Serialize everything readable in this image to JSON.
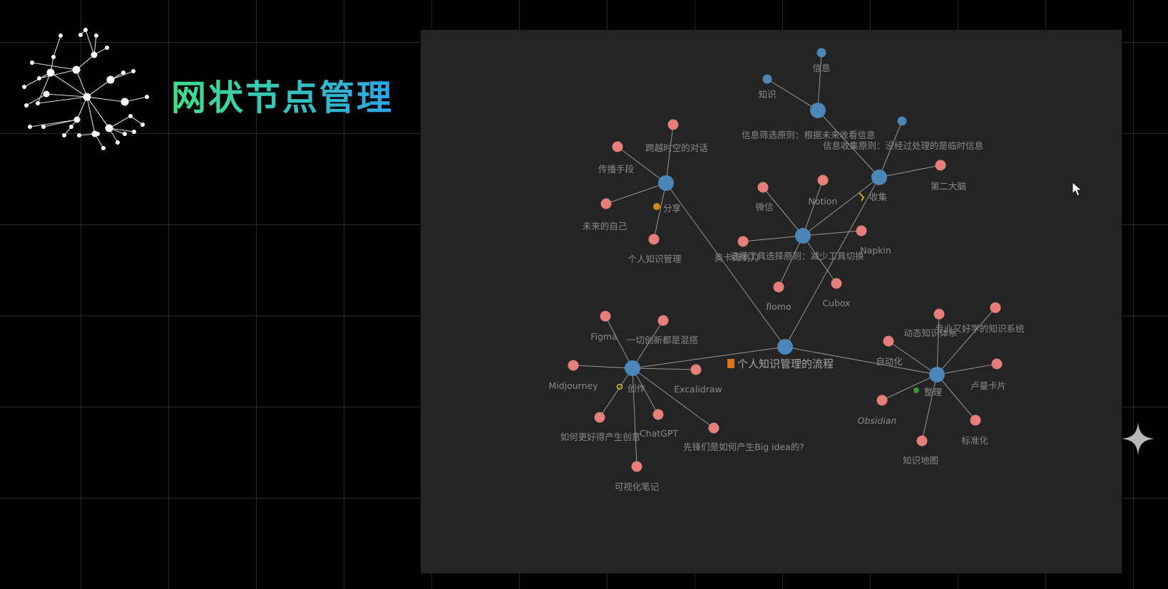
{
  "title": "网状节点管理",
  "icons": {
    "logo": "network-graph-icon",
    "cursor": "mouse-cursor-icon",
    "sparkle": "sparkle-icon"
  },
  "colors": {
    "title_gradient_start": "#3fe08a",
    "title_gradient_end": "#2ba4e8",
    "panel_bg": "#242424",
    "hub_node": "#4b86b8",
    "leaf_node": "#e57f7a",
    "edge": "#bdbdbd",
    "label": "#8a8a8a"
  },
  "graph": {
    "nodes": [
      {
        "id": "root",
        "label": "个人知识管理的流程",
        "kind": "hub",
        "main": true,
        "marker": "note-icon"
      },
      {
        "id": "collect",
        "label": "收集",
        "kind": "hub",
        "marker": "tag-icon"
      },
      {
        "id": "tools",
        "label": "选择工具选择原则：减少工具切换",
        "kind": "hub"
      },
      {
        "id": "share",
        "label": "分享",
        "kind": "hub",
        "marker": "dot-icon"
      },
      {
        "id": "create",
        "label": "创作",
        "kind": "hub",
        "marker": "bulb-icon"
      },
      {
        "id": "organize",
        "label": "整理",
        "kind": "hub",
        "marker": "leaf-icon"
      },
      {
        "id": "filter",
        "label": "信息筛选原则：根据未来收看信息",
        "kind": "hub"
      },
      {
        "id": "info",
        "label": "信息",
        "kind": "hub-small"
      },
      {
        "id": "knowledge",
        "label": "知识",
        "kind": "hub-small"
      },
      {
        "id": "collect-rule",
        "label": "信息收集原则：没经过处理的是临时信息",
        "kind": "hub-small"
      },
      {
        "id": "second-brain",
        "label": "第二大脑",
        "kind": "leaf"
      },
      {
        "id": "wechat",
        "label": "微信",
        "kind": "leaf"
      },
      {
        "id": "notion",
        "label": "Notion",
        "kind": "leaf"
      },
      {
        "id": "napkin",
        "label": "Napkin",
        "kind": "leaf"
      },
      {
        "id": "thoughts",
        "label": "奥卡姆剃刀",
        "kind": "leaf"
      },
      {
        "id": "flomo",
        "label": "flomo",
        "kind": "leaf"
      },
      {
        "id": "cubox",
        "label": "Cubox",
        "kind": "leaf"
      },
      {
        "id": "dialog",
        "label": "跨越时空的对话",
        "kind": "leaf"
      },
      {
        "id": "spread",
        "label": "传播手段",
        "kind": "leaf"
      },
      {
        "id": "future-self",
        "label": "未来的自己",
        "kind": "leaf"
      },
      {
        "id": "pkm",
        "label": "个人知识管理",
        "kind": "leaf"
      },
      {
        "id": "figma",
        "label": "Figma",
        "kind": "leaf"
      },
      {
        "id": "remix",
        "label": "一切创新都是混搭",
        "kind": "leaf"
      },
      {
        "id": "midjourney",
        "label": "Midjourney",
        "kind": "leaf"
      },
      {
        "id": "excalidraw",
        "label": "Excalidraw",
        "kind": "leaf"
      },
      {
        "id": "better-idea",
        "label": "如何更好得产生创意",
        "kind": "leaf"
      },
      {
        "id": "chatgpt",
        "label": "ChatGPT",
        "kind": "leaf"
      },
      {
        "id": "big-idea",
        "label": "先锋们是如何产生Big idea的?",
        "kind": "leaf"
      },
      {
        "id": "visual-notes",
        "label": "可视化笔记",
        "kind": "leaf"
      },
      {
        "id": "pro-system",
        "label": "专业又好学的知识系统",
        "kind": "leaf"
      },
      {
        "id": "dynamic",
        "label": "动态知识体系",
        "kind": "leaf"
      },
      {
        "id": "automation",
        "label": "自动化",
        "kind": "leaf"
      },
      {
        "id": "zettel",
        "label": "卢曼卡片",
        "kind": "leaf"
      },
      {
        "id": "obsidian",
        "label": "Obsidian",
        "kind": "leaf",
        "italic": true
      },
      {
        "id": "standard",
        "label": "标准化",
        "kind": "leaf"
      },
      {
        "id": "mindmap",
        "label": "知识地图",
        "kind": "leaf"
      }
    ]
  }
}
